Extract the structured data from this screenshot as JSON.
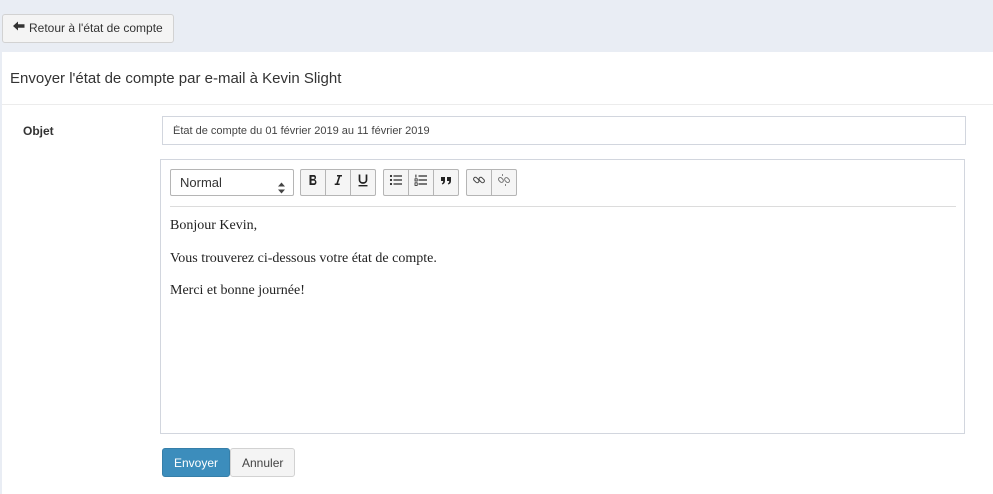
{
  "topbar": {
    "back_label": "Retour à l'état de compte"
  },
  "panel": {
    "title": "Envoyer l'état de compte par e-mail à Kevin Slight"
  },
  "form": {
    "subject_label": "Objet",
    "subject_value": "État de compte du 01 février 2019 au 11 février 2019"
  },
  "editor": {
    "format_value": "Normal",
    "toolbar_icons": [
      "bold-icon",
      "italic-icon",
      "underline-icon",
      "bulleted-list-icon",
      "numbered-list-icon",
      "blockquote-icon",
      "link-icon",
      "unlink-icon"
    ],
    "lines": [
      "Bonjour Kevin,",
      "Vous trouverez ci-dessous votre état de compte.",
      "Merci et bonne journée!"
    ]
  },
  "actions": {
    "send_label": "Envoyer",
    "cancel_label": "Annuler"
  },
  "colors": {
    "primary": "#3c8dbc",
    "page_bg": "#e9edf4"
  }
}
